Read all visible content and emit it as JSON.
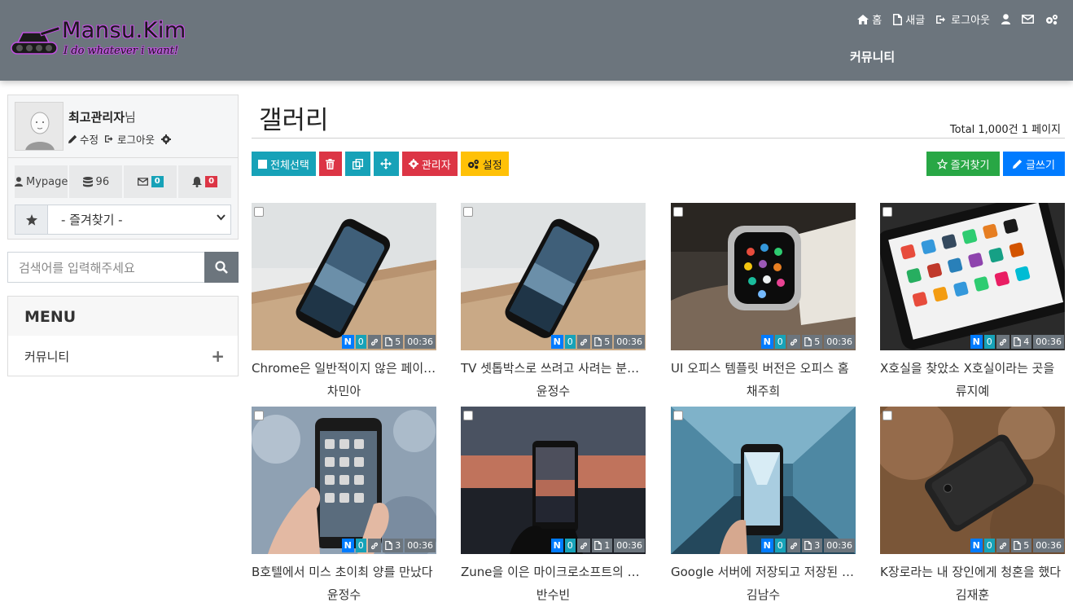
{
  "site": {
    "name": "Mansu.Kim",
    "slogan": "I do whatever i want!"
  },
  "topnav": {
    "home": "홈",
    "new_posts": "새글",
    "logout": "로그아웃",
    "community": "커뮤니티"
  },
  "profile": {
    "name": "최고관리자",
    "suffix": "님",
    "edit": "수정",
    "logout": "로그아웃",
    "mypage": "Mypage",
    "points": "96",
    "memo_count": "0",
    "alarm_count": "0",
    "favorites_placeholder": "- 즐겨찾기 -"
  },
  "search": {
    "placeholder": "검색어를 입력해주세요"
  },
  "menu": {
    "title": "MENU",
    "items": [
      {
        "label": "커뮤니티"
      }
    ]
  },
  "board": {
    "title": "갤러리",
    "total": "Total 1,000건 1 페이지",
    "buttons": {
      "select_all": "전체선택",
      "admin": "관리자",
      "settings": "설정",
      "favorite": "즐겨찾기",
      "write": "글쓰기"
    }
  },
  "posts": [
    {
      "title": "Chrome은 일반적이지 않은 페이지를 보여준다",
      "author": "차민아",
      "new": "N",
      "comments": "0",
      "files": "5",
      "time": "00:36"
    },
    {
      "title": "TV 셋톱박스로 쓰려고 사려는 분들께",
      "author": "윤정수",
      "new": "N",
      "comments": "0",
      "files": "5",
      "time": "00:36"
    },
    {
      "title": "UI 오피스 템플릿 버전은 오피스 홈",
      "author": "채주희",
      "new": "N",
      "comments": "0",
      "files": "5",
      "time": "00:36"
    },
    {
      "title": "X호실을 찾았소 X호실이라는 곳을",
      "author": "류지예",
      "new": "N",
      "comments": "0",
      "files": "4",
      "time": "00:36"
    },
    {
      "title": "B호텔에서 미스 초이최 양를 만났다",
      "author": "윤정수",
      "new": "N",
      "comments": "0",
      "files": "3",
      "time": "00:36"
    },
    {
      "title": "Zune을 이은 마이크로소프트의 기기",
      "author": "반수빈",
      "new": "N",
      "comments": "0",
      "files": "1",
      "time": "00:36"
    },
    {
      "title": "Google 서버에 저장되고 저장된 자료",
      "author": "김남수",
      "new": "N",
      "comments": "0",
      "files": "3",
      "time": "00:36"
    },
    {
      "title": "K장로라는 내 장인에게 청혼을 했다",
      "author": "김재훈",
      "new": "N",
      "comments": "0",
      "files": "5",
      "time": "00:36"
    }
  ]
}
